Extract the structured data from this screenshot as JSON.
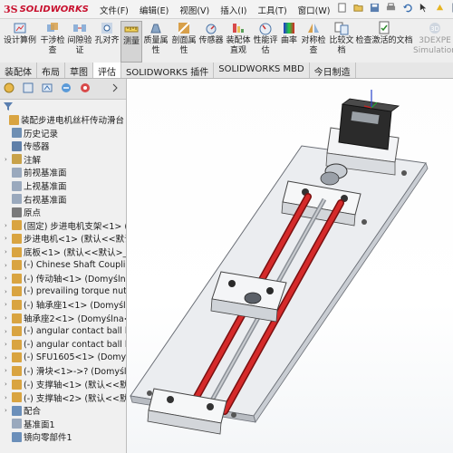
{
  "app": {
    "brand_prefix": "3S",
    "brand_name": "SOLIDWORKS"
  },
  "menu": [
    "文件(F)",
    "编辑(E)",
    "视图(V)",
    "插入(I)",
    "工具(T)",
    "窗口(W)",
    "?"
  ],
  "toolbar": {
    "design_study": "设计算例",
    "interference": "干涉检\n查",
    "clearance": "间隙验\n证",
    "hole_align": "孔对齐",
    "measure": "测量",
    "mass_props": "质量属\n性",
    "section_props": "剖面属\n性",
    "sensor": "传感器",
    "assembly_viz": "装配体\n直观",
    "perf_eval": "性能评\n估",
    "curvature": "曲率",
    "symmetry": "对称检\n查",
    "compare_docs": "比较文\n档",
    "check_active": "检查激活的文档",
    "xpert": "3DEXPE\nSimulation"
  },
  "tabs": [
    "装配体",
    "布局",
    "草图",
    "评估",
    "SOLIDWORKS 插件",
    "SOLIDWORKS MBD",
    "今日制造"
  ],
  "active_tab": 3,
  "tree": [
    {
      "label": "装配步进电机丝杆传动滑台 (默",
      "icon": "assembly-icon",
      "color": "#d9a441",
      "indent": 0,
      "exp": ""
    },
    {
      "label": "历史记录",
      "icon": "history-icon",
      "color": "#6f8fb3",
      "indent": 1,
      "exp": ""
    },
    {
      "label": "传感器",
      "icon": "sensor-icon",
      "color": "#5f7fa8",
      "indent": 1,
      "exp": ""
    },
    {
      "label": "注解",
      "icon": "annotation-icon",
      "color": "#c8a24a",
      "indent": 1,
      "exp": "›"
    },
    {
      "label": "前视基准面",
      "icon": "plane-icon",
      "color": "#9aa9bd",
      "indent": 1,
      "exp": ""
    },
    {
      "label": "上视基准面",
      "icon": "plane-icon",
      "color": "#9aa9bd",
      "indent": 1,
      "exp": ""
    },
    {
      "label": "右视基准面",
      "icon": "plane-icon",
      "color": "#9aa9bd",
      "indent": 1,
      "exp": ""
    },
    {
      "label": "原点",
      "icon": "origin-icon",
      "color": "#7a7a7a",
      "indent": 1,
      "exp": ""
    },
    {
      "label": "(固定) 步进电机支架<1> (默认",
      "icon": "part-icon",
      "color": "#d9a441",
      "indent": 1,
      "exp": "›"
    },
    {
      "label": "步进电机<1> (默认<<默认>",
      "icon": "part-icon",
      "color": "#d9a441",
      "indent": 1,
      "exp": "›"
    },
    {
      "label": "底板<1> (默认<<默认>_显",
      "icon": "part-icon",
      "color": "#d9a441",
      "indent": 1,
      "exp": "›"
    },
    {
      "label": "(-) Chinese Shaft Coupling",
      "icon": "part-icon",
      "color": "#d9a441",
      "indent": 1,
      "exp": "›"
    },
    {
      "label": "(-) 传动轴<1> (Domyślna<",
      "icon": "part-icon",
      "color": "#d9a441",
      "indent": 1,
      "exp": "›"
    },
    {
      "label": "(-) prevailing torque nut st",
      "icon": "part-icon",
      "color": "#d9a441",
      "indent": 1,
      "exp": "›"
    },
    {
      "label": "(-) 轴承座1<1> (Domyślna>",
      "icon": "part-icon",
      "color": "#d9a441",
      "indent": 1,
      "exp": "›"
    },
    {
      "label": "轴承座2<1> (Domyślna<<",
      "icon": "part-icon",
      "color": "#d9a441",
      "indent": 1,
      "exp": "›"
    },
    {
      "label": "(-) angular contact ball be",
      "icon": "part-icon",
      "color": "#d9a441",
      "indent": 1,
      "exp": "›"
    },
    {
      "label": "(-) angular contact ball be",
      "icon": "part-icon",
      "color": "#d9a441",
      "indent": 1,
      "exp": "›"
    },
    {
      "label": "(-) SFU1605<1> (Domyśln",
      "icon": "part-icon",
      "color": "#d9a441",
      "indent": 1,
      "exp": "›"
    },
    {
      "label": "(-) 滑块<1>->? (Domyśln",
      "icon": "part-icon",
      "color": "#d9a441",
      "indent": 1,
      "exp": "›"
    },
    {
      "label": "(-) 支撑轴<1> (默认<<默认>",
      "icon": "part-icon",
      "color": "#d9a441",
      "indent": 1,
      "exp": "›"
    },
    {
      "label": "(-) 支撑轴<2> (默认<<默认>",
      "icon": "part-icon",
      "color": "#d9a441",
      "indent": 1,
      "exp": "›"
    },
    {
      "label": "配合",
      "icon": "mates-icon",
      "color": "#6b8fba",
      "indent": 1,
      "exp": "›"
    },
    {
      "label": "基准面1",
      "icon": "plane-icon",
      "color": "#9aa9bd",
      "indent": 1,
      "exp": ""
    },
    {
      "label": "镜向零部件1",
      "icon": "mirror-icon",
      "color": "#6b8fba",
      "indent": 1,
      "exp": ""
    }
  ]
}
